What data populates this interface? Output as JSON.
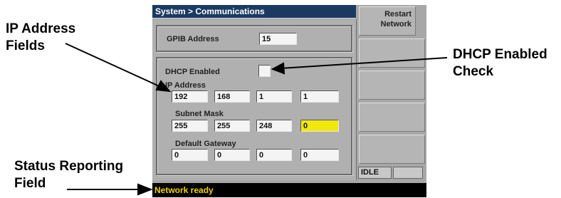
{
  "annotations": {
    "ip_fields": [
      "IP Address",
      "Fields"
    ],
    "dhcp_check": [
      "DHCP Enabled",
      "Check"
    ],
    "status_field": [
      "Status Reporting",
      "Field"
    ]
  },
  "screen": {
    "title": "System > Communications",
    "gpib": {
      "label": "GPIB Address",
      "value": "15"
    },
    "dhcp": {
      "label": "DHCP Enabled",
      "checked": false
    },
    "ip_address": {
      "label": "IP Address",
      "octets": [
        "192",
        "168",
        "1",
        "1"
      ]
    },
    "subnet_mask": {
      "label": "Subnet Mask",
      "octets": [
        "255",
        "255",
        "248",
        "0"
      ]
    },
    "default_gateway": {
      "label": "Default Gateway",
      "octets": [
        "0",
        "0",
        "0",
        "0"
      ]
    },
    "softkeys": [
      {
        "label": "Restart Network"
      },
      {
        "label": ""
      },
      {
        "label": ""
      },
      {
        "label": ""
      },
      {
        "label": ""
      }
    ],
    "status_state": "IDLE",
    "status_extra": "",
    "status_message": "Network ready",
    "colors": {
      "titlebar": "#1b3a62",
      "selected_field": "#f2e80e",
      "status_text": "#f2d100"
    }
  }
}
